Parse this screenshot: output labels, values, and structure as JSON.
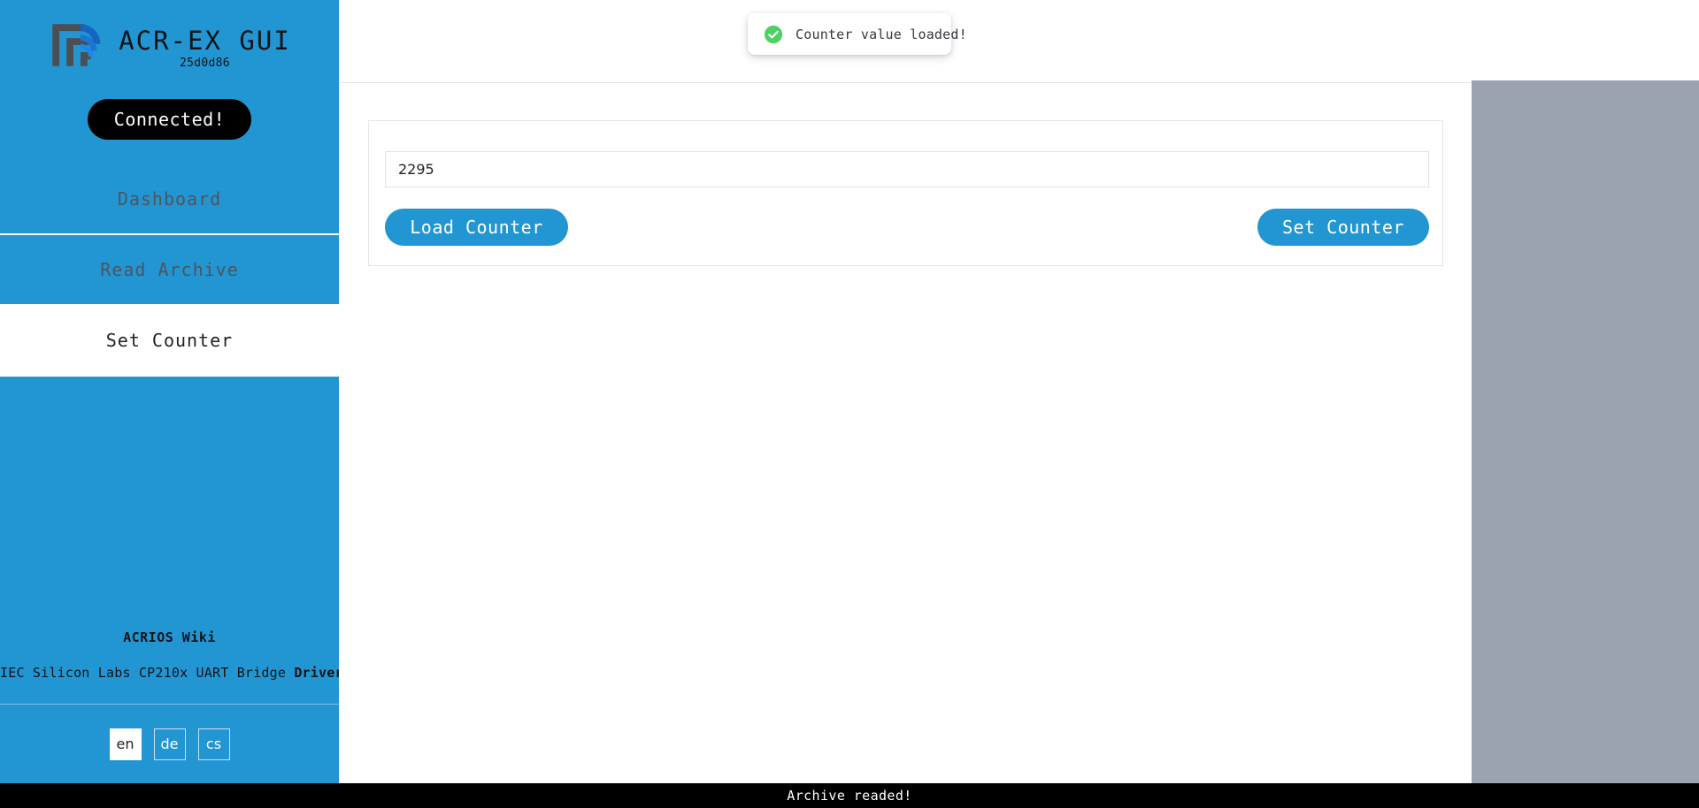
{
  "sidebar": {
    "logo_icon": "acrios-concentric-squares-signal-logo",
    "brand_title": "ACR-EX GUI",
    "version_hash": "25d0d86",
    "connect_button": "Connected!",
    "nav_items": [
      {
        "label": "Dashboard",
        "name": "dashboard",
        "active": false
      },
      {
        "label": "Read Archive",
        "name": "read-archive",
        "active": false
      },
      {
        "label": "Set Counter",
        "name": "set-counter",
        "active": true
      }
    ],
    "wiki_link": "ACRIOS Wiki",
    "drivers_prefix": "IEC Silicon Labs CP210x UART Bridge ",
    "drivers_link": "Drivers",
    "languages": [
      {
        "code": "en",
        "active": true
      },
      {
        "code": "de",
        "active": false
      },
      {
        "code": "cs",
        "active": false
      }
    ]
  },
  "header": {
    "toast": {
      "message": "Counter value loaded!",
      "icon": "check-circle-icon",
      "icon_color": "#4cd263"
    }
  },
  "main": {
    "counter_input": {
      "value": "2295",
      "placeholder": ""
    },
    "load_button": "Load Counter",
    "set_button": "Set Counter"
  },
  "statusbar": {
    "message": "Archive readed!"
  },
  "colors": {
    "brand_blue": "#2196d3",
    "gray_panel": "#9ba3b0",
    "status_bg": "#000000",
    "toast_green": "#4cd263"
  }
}
